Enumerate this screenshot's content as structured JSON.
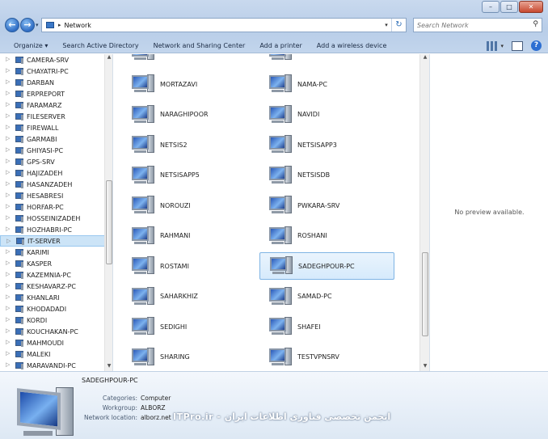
{
  "window": {
    "minimize_glyph": "–",
    "maximize_glyph": "□",
    "close_glyph": "✕"
  },
  "address": {
    "back_glyph": "←",
    "forward_glyph": "→",
    "recent_glyph": "▾",
    "chevron": "▸",
    "crumb": "Network",
    "dropdown_glyph": "▾",
    "refresh_glyph": "↻"
  },
  "search": {
    "placeholder": "Search Network",
    "glyph": "⚲"
  },
  "toolbar": {
    "organize": "Organize ▾",
    "search_ad": "Search Active Directory",
    "network_center": "Network and Sharing Center",
    "add_printer": "Add a printer",
    "add_wireless": "Add a wireless device",
    "views_dd": "▾",
    "help": "?"
  },
  "nav": {
    "expander": "▷",
    "items": [
      "CAMERA-SRV",
      "CHAYATRI-PC",
      "DARBAN",
      "ERPREPORT",
      "FARAMARZ",
      "FILESERVER",
      "FIREWALL",
      "GARMABI",
      "GHIYASI-PC",
      "GPS-SRV",
      "HAJIZADEH",
      "HASANZADEH",
      "HESABRESI",
      "HORFAR-PC",
      "HOSSEINIZADEH",
      "HOZHABRI-PC",
      "IT-SERVER",
      "KARIMI",
      "KASPER",
      "KAZEMNIA-PC",
      "KESHAVARZ-PC",
      "KHANLARI",
      "KHODADADI",
      "KORDI",
      "KOUCHAKAN-PC",
      "MAHMOUDI",
      "MALEKI",
      "MARAVANDI-PC"
    ],
    "selected": "IT-SERVER"
  },
  "scroll": {
    "up": "▲",
    "down": "▼"
  },
  "computers": {
    "col1": [
      "MORTAZAVI",
      "NARAGHIPOOR",
      "NETSIS2",
      "NETSISAPP5",
      "NOROUZI",
      "RAHMANI",
      "ROSTAMI",
      "SAHARKHIZ",
      "SEDIGHI",
      "SHARING"
    ],
    "col2": [
      "NAMA-PC",
      "NAVIDI",
      "NETSISAPP3",
      "NETSISDB",
      "PWKARA-SRV",
      "ROSHANI",
      "SADEGHPOUR-PC",
      "SAMAD-PC",
      "SHAFEI",
      "TESTVPNSRV"
    ],
    "selected": "SADEGHPOUR-PC"
  },
  "preview": {
    "message": "No preview available."
  },
  "details": {
    "title": "SADEGHPOUR-PC",
    "categories_label": "Categories:",
    "categories": "Computer",
    "workgroup_label": "Workgroup:",
    "workgroup": "ALBORZ",
    "location_label": "Network location:",
    "location": "alborz.net",
    "watermark": "ITPro.ir - انجمن تخصصی فناوری اطلاعات ایران"
  }
}
